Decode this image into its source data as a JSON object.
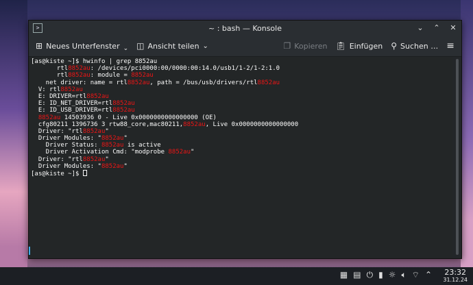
{
  "window": {
    "title": "~ : bash — Konsole",
    "controls": {
      "minimize": "⌄",
      "maximize": "⌃",
      "close": "✕"
    }
  },
  "toolbar": {
    "new_tab_label": "Neues Unterfenster",
    "new_tab_arrow": "⌄",
    "split_view_label": "Ansicht teilen",
    "split_view_arrow": "⌄",
    "copy_label": "Kopieren",
    "paste_label": "Einfügen",
    "search_label": "Suchen …"
  },
  "terminal": {
    "lines": [
      [
        {
          "t": "[as@kiste ~]$ hwinfo | grep 8852au"
        }
      ],
      [
        {
          "t": "       rtl"
        },
        {
          "t": "8852au",
          "h": true
        },
        {
          "t": ": /devices/pci0000:00/0000:00:14.0/usb1/1-2/1-2:1.0"
        }
      ],
      [
        {
          "t": "       rtl"
        },
        {
          "t": "8852au",
          "h": true
        },
        {
          "t": ": module = "
        },
        {
          "t": "8852au",
          "h": true
        }
      ],
      [
        {
          "t": "    net driver: name = rtl"
        },
        {
          "t": "8852au",
          "h": true
        },
        {
          "t": ", path = /bus/usb/drivers/rtl"
        },
        {
          "t": "8852au",
          "h": true
        }
      ],
      [
        {
          "t": "  V: rtl"
        },
        {
          "t": "8852au",
          "h": true
        }
      ],
      [
        {
          "t": "  E: DRIVER=rtl"
        },
        {
          "t": "8852au",
          "h": true
        }
      ],
      [
        {
          "t": "  E: ID_NET_DRIVER=rtl"
        },
        {
          "t": "8852au",
          "h": true
        }
      ],
      [
        {
          "t": "  E: ID_USB_DRIVER=rtl"
        },
        {
          "t": "8852au",
          "h": true
        }
      ],
      [
        {
          "t": "  "
        },
        {
          "t": "8852au",
          "h": true
        },
        {
          "t": " 14503936 0 - Live 0x0000000000000000 (OE)"
        }
      ],
      [
        {
          "t": "  cfg80211 1396736 3 rtw88_core,mac80211,"
        },
        {
          "t": "8852au",
          "h": true
        },
        {
          "t": ", Live 0x0000000000000000"
        }
      ],
      [
        {
          "t": "  Driver: \"rtl"
        },
        {
          "t": "8852au",
          "h": true
        },
        {
          "t": "\""
        }
      ],
      [
        {
          "t": "  Driver Modules: \""
        },
        {
          "t": "8852au",
          "h": true
        },
        {
          "t": "\""
        }
      ],
      [
        {
          "t": "    Driver Status: "
        },
        {
          "t": "8852au",
          "h": true
        },
        {
          "t": " is active"
        }
      ],
      [
        {
          "t": "    Driver Activation Cmd: \"modprobe "
        },
        {
          "t": "8852au",
          "h": true
        },
        {
          "t": "\""
        }
      ],
      [
        {
          "t": "  Driver: \"rtl"
        },
        {
          "t": "8852au",
          "h": true
        },
        {
          "t": "\""
        }
      ],
      [
        {
          "t": "  Driver Modules: \""
        },
        {
          "t": "8852au",
          "h": true
        },
        {
          "t": "\""
        }
      ]
    ],
    "prompt": "[as@kiste ~]$ "
  },
  "panel": {
    "time": "23:32",
    "date": "31.12.24"
  },
  "colors": {
    "highlight": "#ed1515",
    "terminal_bg": "#232627",
    "accent": "#3daee9"
  }
}
